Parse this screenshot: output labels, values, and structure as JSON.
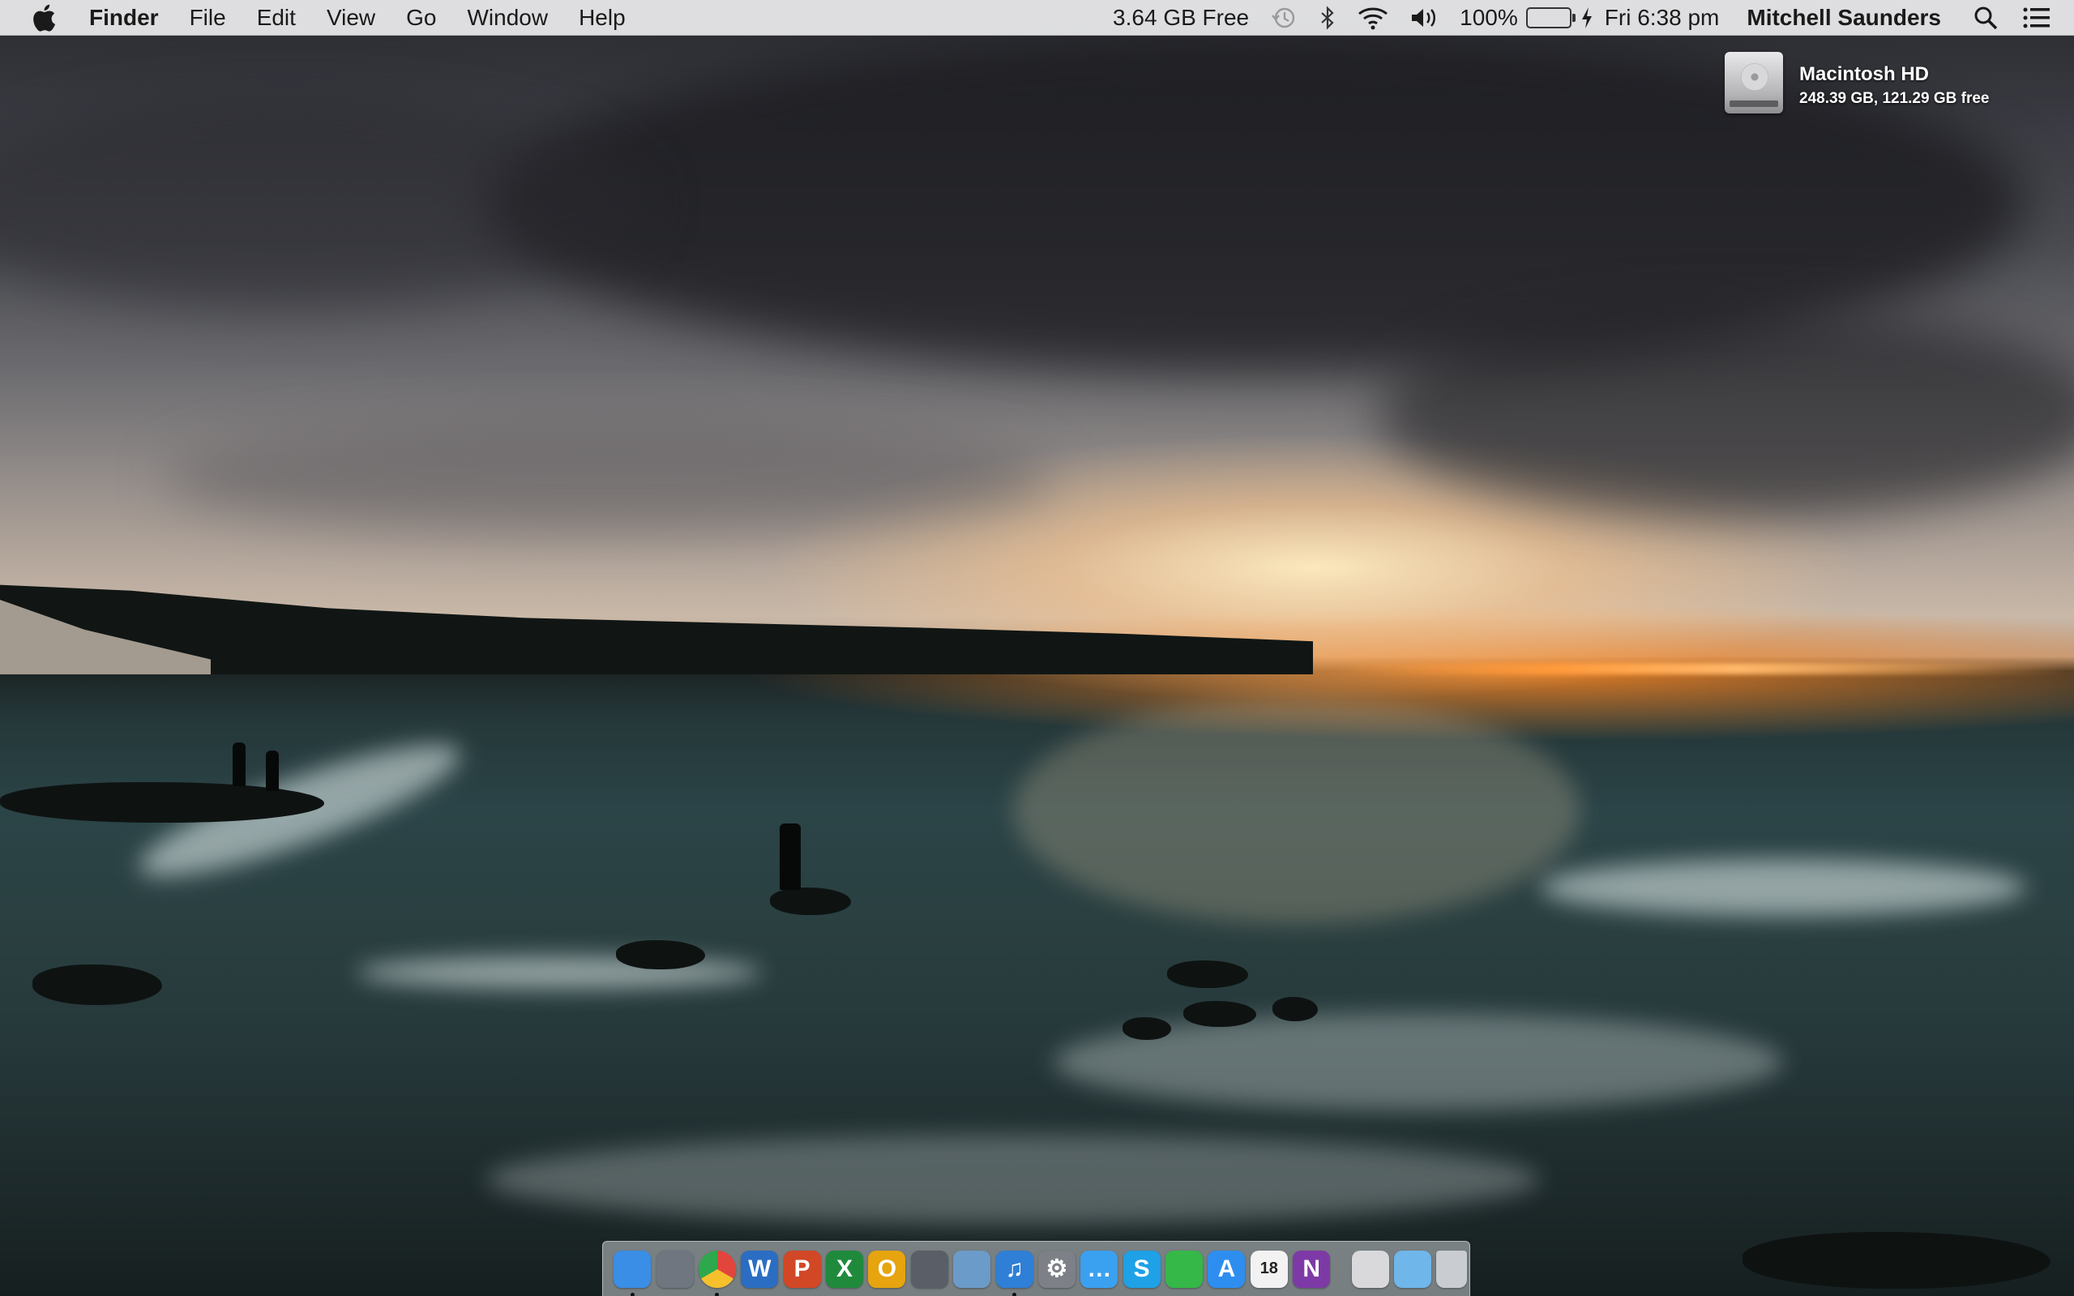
{
  "menubar": {
    "app_name": "Finder",
    "menus": [
      "File",
      "Edit",
      "View",
      "Go",
      "Window",
      "Help"
    ],
    "status": {
      "free_space": "3.64 GB Free",
      "battery_percent": "100%",
      "battery_level": 1.0,
      "clock": "Fri 6:38 pm",
      "user_name": "Mitchell Saunders"
    },
    "icons": [
      "apple-icon",
      "time-machine-icon",
      "bluetooth-icon",
      "wifi-icon",
      "volume-icon",
      "battery-icon",
      "charging-icon",
      "spotlight-icon",
      "notification-center-icon"
    ]
  },
  "desktop": {
    "drive": {
      "name": "Macintosh HD",
      "info": "248.39 GB, 121.29 GB free"
    }
  },
  "dock": {
    "apps": [
      {
        "name": "finder",
        "glyph": "",
        "color": "#3a8ee6",
        "running": true
      },
      {
        "name": "launchpad",
        "glyph": "",
        "color": "#6f7680",
        "running": false
      },
      {
        "name": "chrome",
        "glyph": "",
        "color": "#e2453c",
        "running": true
      },
      {
        "name": "word",
        "glyph": "W",
        "color": "#2b6dc2",
        "running": false
      },
      {
        "name": "powerpoint",
        "glyph": "P",
        "color": "#d24726",
        "running": false
      },
      {
        "name": "excel",
        "glyph": "X",
        "color": "#1f8a3c",
        "running": false
      },
      {
        "name": "outlook",
        "glyph": "O",
        "color": "#e6a40f",
        "running": false
      },
      {
        "name": "final-cut",
        "glyph": "",
        "color": "#5a5e66",
        "running": false
      },
      {
        "name": "preview",
        "glyph": "",
        "color": "#6b9bc8",
        "running": false
      },
      {
        "name": "itunes",
        "glyph": "♫",
        "color": "#2f7fd6",
        "running": true
      },
      {
        "name": "system-preferences",
        "glyph": "⚙",
        "color": "#7d8087",
        "running": false
      },
      {
        "name": "messages",
        "glyph": "…",
        "color": "#3aa0f0",
        "running": false
      },
      {
        "name": "skype",
        "glyph": "S",
        "color": "#1ea1e6",
        "running": false
      },
      {
        "name": "facetime",
        "glyph": "",
        "color": "#35b848",
        "running": false
      },
      {
        "name": "app-store",
        "glyph": "A",
        "color": "#2e8ef0",
        "running": false
      },
      {
        "name": "calendar",
        "glyph": "18",
        "color": "#f2f2f2",
        "running": false
      },
      {
        "name": "onenote",
        "glyph": "N",
        "color": "#7d3aa6",
        "running": false
      }
    ],
    "extras": [
      {
        "name": "documents-stack",
        "color": "#d9d9db"
      },
      {
        "name": "downloads-folder",
        "color": "#6fb6ea"
      },
      {
        "name": "trash",
        "color": "#c9ccd0"
      }
    ]
  }
}
